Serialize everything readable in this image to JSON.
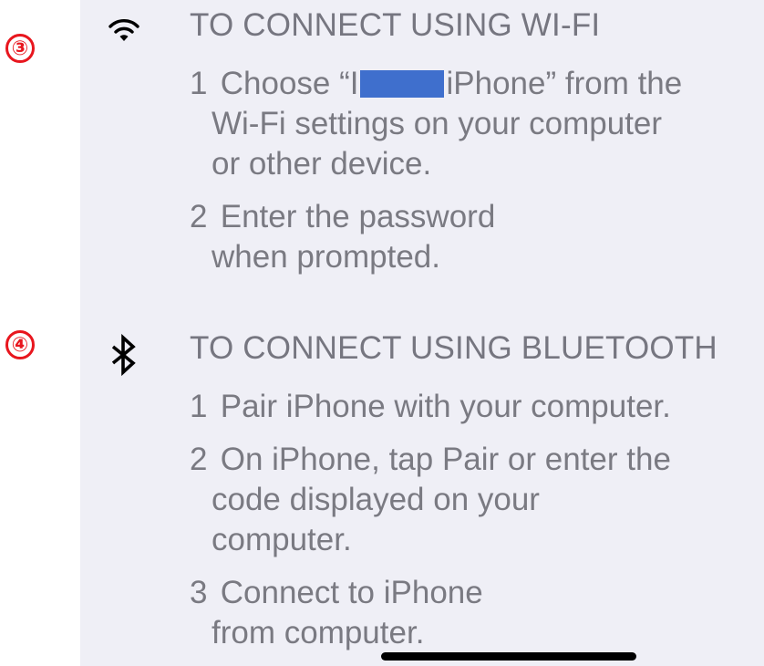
{
  "badges": [
    "③",
    "④"
  ],
  "wifi": {
    "icon": "wifi-icon",
    "heading": "TO CONNECT USING WI-FI",
    "steps": [
      {
        "num": "1",
        "lines": [
          "Choose “I",
          "iPhone” from the",
          "Wi-Fi settings on your computer",
          "or other device."
        ]
      },
      {
        "num": "2",
        "lines": [
          "Enter the password",
          "when prompted."
        ]
      }
    ]
  },
  "bluetooth": {
    "icon": "bluetooth-icon",
    "heading": "TO CONNECT USING BLUETOOTH",
    "steps": [
      {
        "num": "1",
        "lines": [
          "Pair iPhone with your computer."
        ]
      },
      {
        "num": "2",
        "lines": [
          "On iPhone, tap Pair or enter the",
          "code displayed on your",
          "computer."
        ]
      },
      {
        "num": "3",
        "lines": [
          "Connect to iPhone",
          "from computer."
        ]
      }
    ]
  },
  "colors": {
    "background": "#efeff6",
    "text": "#7a7a82",
    "badge": "#e8161e",
    "redaction": "#3f6fcd"
  }
}
